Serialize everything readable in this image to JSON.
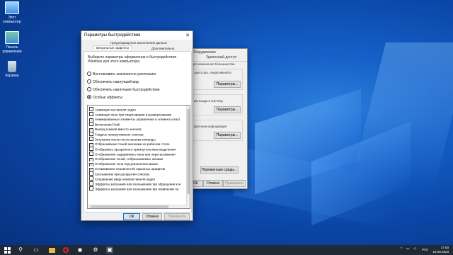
{
  "desktop": {
    "icons": [
      {
        "label_line1": "Этот",
        "label_line2": "компьютер",
        "icon": "computer-icon"
      },
      {
        "label_line1": "Панель",
        "label_line2": "управления",
        "icon": "control-panel-icon"
      },
      {
        "label_line1": "Корзина",
        "label_line2": "",
        "icon": "recycle-bin-icon"
      }
    ]
  },
  "system_dialog": {
    "tab_top": "Оборудование",
    "tab_left": "а",
    "tab_right": "Удаленный доступ",
    "note": "для изменения большинства",
    "group1_text": "оцессора, оперативной и",
    "group1_button": "Параметры...",
    "group2_text": "ию входа в систему",
    "group2_button": "Параметры...",
    "group3_text": "ladочная информация",
    "group3_button": "Параметры...",
    "env_button": "Переменные среды...",
    "ok": "ОК",
    "cancel": "Отмена",
    "apply": "Применить"
  },
  "perf_dialog": {
    "title": "Параметры быстродействия",
    "close_glyph": "✕",
    "tab_prevention": "Предотвращение выполнения данных",
    "tab_visual": "Визуальные эффекты",
    "tab_advanced": "Дополнительно",
    "description": "Выберите параметры оформления и быстродействия Windows для этого компьютера.",
    "radios": [
      {
        "label": "Восстановить значения по умолчанию",
        "selected": false
      },
      {
        "label": "Обеспечить наилучший вид",
        "selected": false
      },
      {
        "label": "Обеспечить наилучшее быстродействие",
        "selected": false
      },
      {
        "label": "Особые эффекты:",
        "selected": true
      }
    ],
    "effects": [
      {
        "label": "Анимация на панели задач",
        "checked": false
      },
      {
        "label": "Анимация окон при свертывании и развертывании",
        "checked": false
      },
      {
        "label": "Анимированные элементы управления и элементы внут",
        "checked": true
      },
      {
        "label": "Включение Peek",
        "checked": false
      },
      {
        "label": "Вывод эскизов вместо значков",
        "checked": true
      },
      {
        "label": "Гладкое прокручивание списков",
        "checked": false
      },
      {
        "label": "Затухание меню после вызова команды",
        "checked": false
      },
      {
        "label": "Отбрасывание теней значками на рабочем столе",
        "checked": true
      },
      {
        "label": "Отображать прозрачного прямоугольника выделения",
        "checked": false
      },
      {
        "label": "Отображение содержимого окна при перетаскивании",
        "checked": false
      },
      {
        "label": "Отображение теней, отбрасываемых окнами",
        "checked": true
      },
      {
        "label": "Отображение тени под указателем мыши",
        "checked": true
      },
      {
        "label": "Сглаживание неровностей экранных шрифтов",
        "checked": true
      },
      {
        "label": "Скольжение при раскрытии списков",
        "checked": false
      },
      {
        "label": "Сохранение вида эскизов панели задач",
        "checked": false
      },
      {
        "label": "Эффекты затухания или скольжения при обращении к м",
        "checked": false
      },
      {
        "label": "Эффекты затухания или скольжения при появлении по",
        "checked": false
      }
    ],
    "ok": "ОК",
    "cancel": "Отмена",
    "apply": "Применить"
  },
  "taskbar": {
    "language": "РУС",
    "time": "17:50",
    "date": "19.08.2023"
  }
}
